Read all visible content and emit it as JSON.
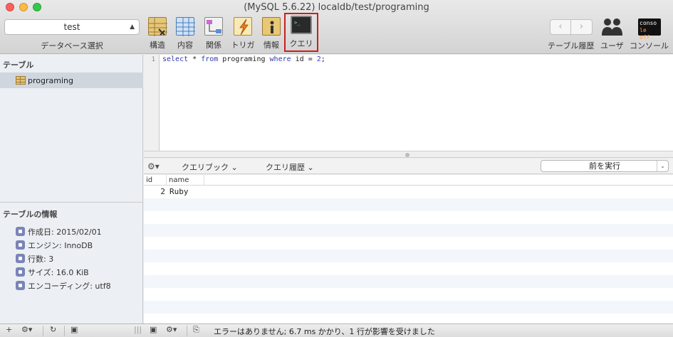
{
  "window": {
    "title": "(MySQL 5.6.22) localdb/test/programing"
  },
  "database_select": {
    "value": "test",
    "caption": "データベース選択"
  },
  "toolbar": {
    "tools": [
      {
        "label": "構造"
      },
      {
        "label": "内容"
      },
      {
        "label": "関係"
      },
      {
        "label": "トリガ"
      },
      {
        "label": "情報"
      },
      {
        "label": "クエリ"
      }
    ],
    "history_caption": "テーブル履歴",
    "users_caption": "ユーザ",
    "console_caption": "コンソール",
    "console_icon_text_1": "conso",
    "console_icon_text_2": "le off",
    "back_glyph": "‹",
    "forward_glyph": "›"
  },
  "sidebar": {
    "tables_header": "テーブル",
    "tables": [
      {
        "name": "programing"
      }
    ],
    "info_header": "テーブルの情報",
    "info": [
      {
        "text": "作成日: 2015/02/01"
      },
      {
        "text": "エンジン: InnoDB"
      },
      {
        "text": "行数: 3"
      },
      {
        "text": "サイズ: 16.0 KiB"
      },
      {
        "text": "エンコーディング: utf8"
      }
    ]
  },
  "editor": {
    "line_number": "1",
    "code_parts": {
      "kw1": "select",
      "t1": " * ",
      "kw2": "from",
      "t2": " programing ",
      "kw3": "where",
      "t3": " id = ",
      "num": "2",
      "t4": ";"
    }
  },
  "query_bar": {
    "favorites": "クエリブック",
    "history": "クエリ履歴",
    "run_button": "前を実行"
  },
  "results": {
    "columns": [
      "id",
      "name"
    ],
    "rows": [
      [
        "2",
        "Ruby"
      ]
    ]
  },
  "status": {
    "message": "エラーはありません; 6.7 ms かかり、1 行が影響を受けました"
  },
  "colors": {
    "selection_outline": "#c8201c",
    "table_selected_bg": "#cfd6de",
    "keyword": "#2e3aa8"
  }
}
